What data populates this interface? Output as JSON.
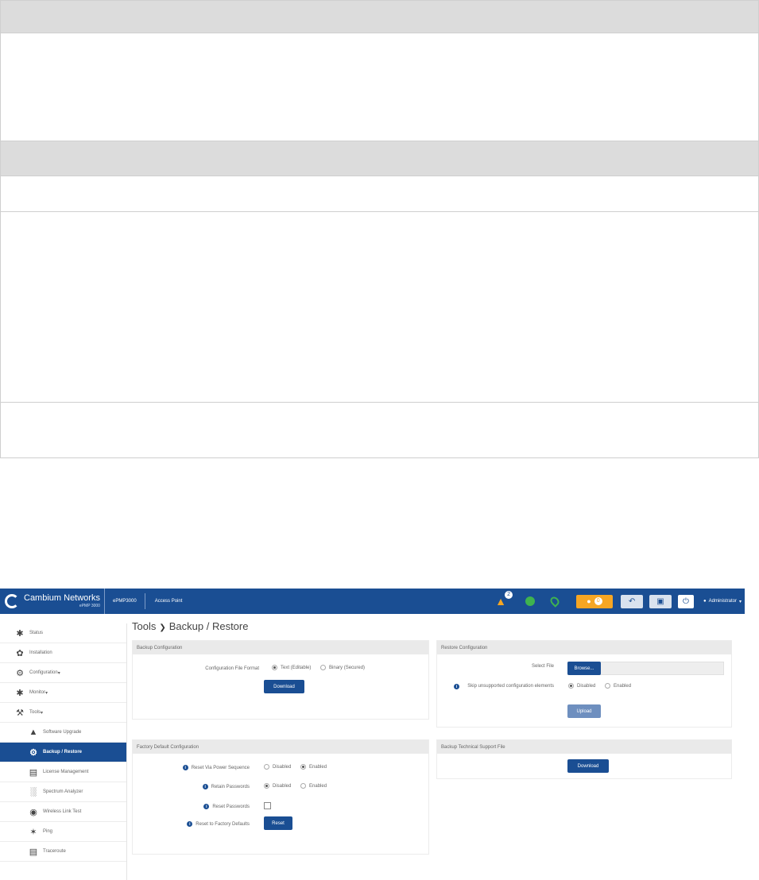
{
  "header": {
    "logo_name": "Cambium Networks",
    "logo_sub": "ePMP 3000",
    "device": "ePMP3000",
    "mode": "Access Point",
    "alarm_count": "2",
    "warning_count": "0",
    "user": "Administrator"
  },
  "sidebar": {
    "items": [
      {
        "label": "Status",
        "icon": "pulse-icon"
      },
      {
        "label": "Installation",
        "icon": "runner-icon"
      },
      {
        "label": "Configuration",
        "icon": "gear-icon"
      },
      {
        "label": "Monitor",
        "icon": "pulse-icon"
      },
      {
        "label": "Tools",
        "icon": "wrench-icon"
      },
      {
        "label": "Software Upgrade",
        "icon": "upload-icon"
      },
      {
        "label": "Backup / Restore",
        "icon": "backup-icon"
      },
      {
        "label": "License Management",
        "icon": "license-icon"
      },
      {
        "label": "Spectrum Analyzer",
        "icon": "spectrum-icon"
      },
      {
        "label": "Wireless Link Test",
        "icon": "link-test-icon"
      },
      {
        "label": "Ping",
        "icon": "ping-icon"
      },
      {
        "label": "Traceroute",
        "icon": "traceroute-icon"
      }
    ]
  },
  "page": {
    "title": "Tools",
    "subtitle": "Backup / Restore"
  },
  "backup": {
    "title": "Backup Configuration",
    "format_label": "Configuration File Format",
    "opt_text": "Text (Editable)",
    "opt_binary": "Binary (Secured)",
    "download": "Download"
  },
  "restore": {
    "title": "Restore Configuration",
    "select_label": "Select File",
    "browse": "Browse...",
    "skip_label": "Skip unsupported configuration elements",
    "disabled": "Disabled",
    "enabled": "Enabled",
    "upload": "Upload"
  },
  "factory": {
    "title": "Factory Default Configuration",
    "reset_seq_label": "Reset Via Power Sequence",
    "retain_label": "Retain Passwords",
    "reset_pw_label": "Reset Passwords",
    "reset_factory_label": "Reset to Factory Defaults",
    "disabled": "Disabled",
    "enabled": "Enabled",
    "reset": "Reset"
  },
  "support": {
    "title": "Backup Technical Support File",
    "download": "Download"
  }
}
